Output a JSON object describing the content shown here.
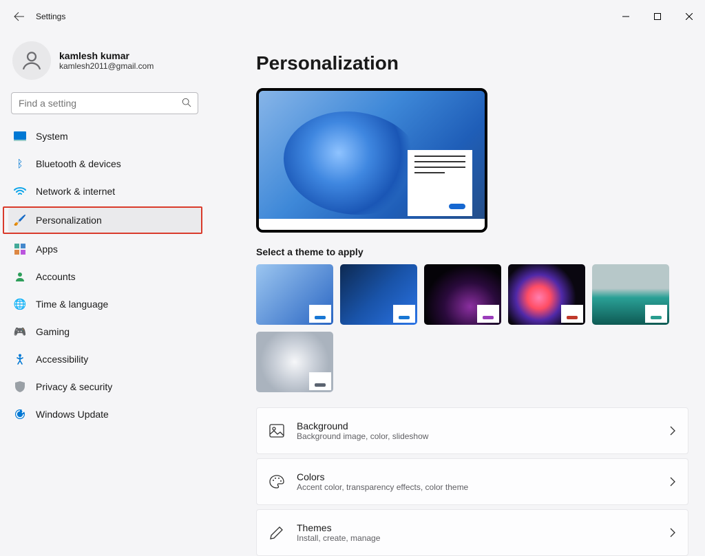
{
  "titlebar": {
    "title": "Settings"
  },
  "user": {
    "name": "kamlesh kumar",
    "email": "kamlesh2011@gmail.com"
  },
  "search": {
    "placeholder": "Find a setting"
  },
  "nav": {
    "system": "System",
    "bluetooth": "Bluetooth & devices",
    "network": "Network & internet",
    "personalization": "Personalization",
    "apps": "Apps",
    "accounts": "Accounts",
    "time": "Time & language",
    "gaming": "Gaming",
    "accessibility": "Accessibility",
    "privacy": "Privacy & security",
    "update": "Windows Update"
  },
  "page": {
    "title": "Personalization",
    "theme_label": "Select a theme to apply"
  },
  "rows": {
    "background": {
      "title": "Background",
      "desc": "Background image, color, slideshow"
    },
    "colors": {
      "title": "Colors",
      "desc": "Accent color, transparency effects, color theme"
    },
    "themes": {
      "title": "Themes",
      "desc": "Install, create, manage"
    }
  }
}
